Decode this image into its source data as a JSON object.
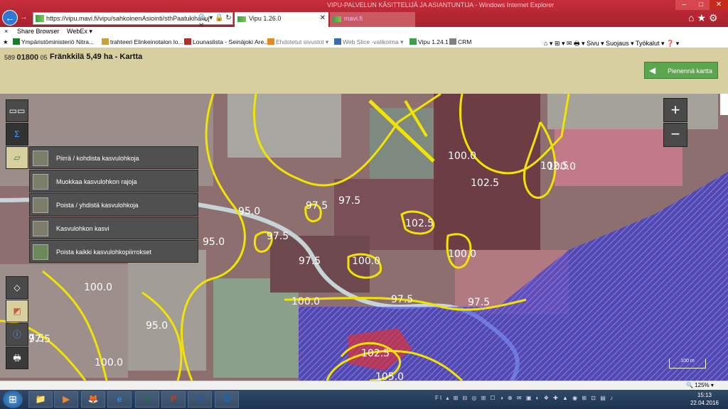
{
  "browser": {
    "window_title": "VIPU-PALVELUN KÄSITTELIJÄ JA ASIANTUNTIJA - Windows Internet Explorer",
    "address": "https://vipu.mavi.fi/vipu/sahkoinenAsiointi/sthPaatukihakuj",
    "tabs": [
      {
        "label": "Vipu 1.26.0",
        "active": true
      },
      {
        "label": "mavi.fi",
        "active": false
      }
    ],
    "menubar": {
      "close": "×",
      "share": "Share Browser",
      "webex": "WebEx ▾"
    },
    "favorites": [
      {
        "label": "Ympäristöministeriö  Nitra...",
        "color": "#1a7a2c"
      },
      {
        "label": "trahteeri Elinkeinotalon lo...",
        "color": "#c8a040"
      },
      {
        "label": "Lounaslista - Seinäjoki Are...",
        "color": "#b03030"
      },
      {
        "label": "Ehdotetut sivustot ▾",
        "color": "#e48a20",
        "dim": true
      },
      {
        "label": "Web Slice -valikoima ▾",
        "color": "#3a6ab0",
        "dim": true
      },
      {
        "label": "Vipu 1.24.1",
        "color": "#3aa04a"
      },
      {
        "label": "CRM",
        "color": "#808080"
      }
    ],
    "toolbar_right": "⌂ ▾  ⊞ ▾  ✉  🖶 ▾  Sivu ▾  Suojaus ▾  Työkalut ▾  ❓ ▾",
    "zoom": "🔍 125%  ▾"
  },
  "app": {
    "parcel_prefix": "589",
    "parcel_number": "01800",
    "parcel_suffix": "05",
    "title": "Fränkkilä 5,49 ha - Kartta",
    "shrink_button": "Pienennä kartta"
  },
  "map": {
    "draw_menu": [
      "Piirrä / kohdista kasvulohkoja",
      "Muokkaa kasvulohkon rajoja",
      "Poista / yhdistä kasvulohkoja",
      "Kasvulohkon kasvi",
      "Poista kaikki kasvulohkopiirrokset"
    ],
    "zoom_in": "+",
    "zoom_out": "−",
    "scale": "100 m",
    "contour_labels": [
      "100.0",
      "102.5",
      "100.0",
      "102.5",
      "97.5",
      "97.5",
      "95.0",
      "102.5",
      "97.5",
      "95.0",
      "97.5",
      "100.0",
      "100.0",
      "100.0",
      "97.5",
      "97.5",
      "100.0",
      "95.0",
      "97.5",
      "100.0",
      "102.5",
      "105.0",
      "7.5"
    ]
  },
  "taskbar": {
    "start": "⊞",
    "apps": [
      {
        "label": "📁",
        "color": "#e8c050"
      },
      {
        "label": "▶",
        "color": "#e88a30"
      },
      {
        "label": "🦊",
        "color": "#e06020"
      },
      {
        "label": "e",
        "color": "#3a8ad8"
      },
      {
        "label": "X",
        "color": "#207245"
      },
      {
        "label": "P",
        "color": "#c43e1c"
      },
      {
        "label": "W",
        "color": "#2b579a"
      },
      {
        "label": "O",
        "color": "#0072c6"
      }
    ],
    "tray": "FI ▴ ⊞ ⊟ ◎ ⊞ ☐ ◑ ⊕ ✉ ▣ ◐ ❖ ✚ ▲ ◉ ⊞ ⊡ ▤ ♪",
    "time": "15:13",
    "date": "22.04.2016"
  }
}
